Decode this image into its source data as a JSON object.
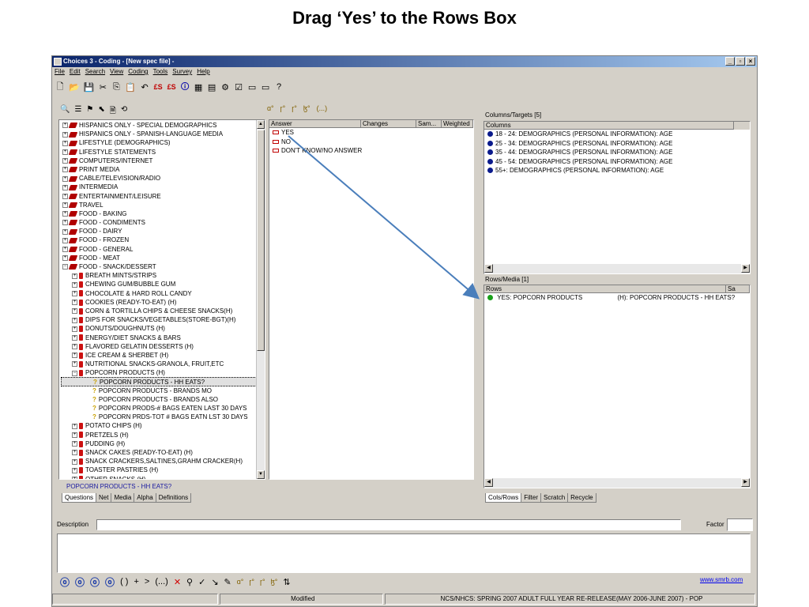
{
  "slide": {
    "title": "Drag ‘Yes’ to the Rows Box"
  },
  "window": {
    "title": "Choices 3 - Coding - [New spec file] -",
    "buttons": [
      "_",
      "▫",
      "×"
    ]
  },
  "menu": [
    "File",
    "Edit",
    "Search",
    "View",
    "Coding",
    "Tools",
    "Survey",
    "Help"
  ],
  "toolbar": [
    "🗋",
    "📂",
    "💾",
    "✂",
    "⎘",
    "📋",
    "↶",
    "£S",
    "£S",
    "🛈",
    "▦",
    "▤",
    "⚙",
    "☑",
    "▭",
    "▭",
    "?"
  ],
  "left_toolbar": [
    "🔍",
    "☰",
    "⚑",
    "⬉",
    "🗎",
    "⟲"
  ],
  "mid_toolbar": [
    "ɑ°",
    "ɼ°",
    "ɼ°",
    "ɮ°",
    "(...)"
  ],
  "tree": {
    "categories": [
      "HISPANICS ONLY - SPECIAL DEMOGRAPHICS",
      "HISPANICS ONLY - SPANISH-LANGUAGE MEDIA",
      "LIFESTYLE (DEMOGRAPHICS)",
      "LIFESTYLE STATEMENTS",
      "COMPUTERS/INTERNET",
      "PRINT MEDIA",
      "CABLE/TELEVISION/RADIO",
      "INTERMEDIA",
      "ENTERTAINMENT/LEISURE",
      "TRAVEL",
      "FOOD - BAKING",
      "FOOD - CONDIMENTS",
      "FOOD - DAIRY",
      "FOOD - FROZEN",
      "FOOD - GENERAL",
      "FOOD - MEAT"
    ],
    "open_category": "FOOD - SNACK/DESSERT",
    "subitems_before": [
      "BREATH MINTS/STRIPS",
      "CHEWING GUM/BUBBLE GUM",
      "CHOCOLATE & HARD ROLL CANDY",
      "COOKIES (READY-TO-EAT)          (H)",
      "CORN & TORTILLA CHIPS & CHEESE SNACKS(H)",
      "DIPS FOR SNACKS/VEGETABLES(STORE-BGT)(H)",
      "DONUTS/DOUGHNUTS               (H)",
      "ENERGY/DIET SNACKS & BARS",
      "FLAVORED GELATIN DESSERTS        (H)",
      "ICE CREAM & SHERBET              (H)",
      "NUTRITIONAL SNACKS-GRANOLA, FRUIT,ETC"
    ],
    "open_subitem": "POPCORN PRODUCTS                (H)",
    "questions": [
      "POPCORN PRODUCTS - HH EATS?",
      "POPCORN PRODUCTS - BRANDS MO",
      "POPCORN PRODUCTS - BRANDS ALSO",
      "POPCORN PRODS-# BAGS EATEN LAST 30 DAYS",
      "POPCORN PRDS-TOT # BAGS EATN LST 30 DAYS"
    ],
    "subitems_after": [
      "POTATO CHIPS                    (H)",
      "PRETZELS                        (H)",
      "PUDDING                         (H)",
      "SNACK CAKES (READY-TO-EAT)       (H)",
      "SNACK CRACKERS,SALTINES,GRAHM CRACKER(H)",
      "TOASTER PASTRIES                (H)",
      "OTHER SNACKS                    (H)"
    ],
    "selected_label": "POPCORN PRODUCTS - HH EATS?"
  },
  "left_tabs": [
    "Questions",
    "Net",
    "Media",
    "Alpha",
    "Definitions"
  ],
  "answers": {
    "headers": [
      "Answer",
      "Changes",
      "Sam...",
      "Weighted"
    ],
    "rows": [
      "YES",
      "NO",
      "DON'T KNOW/NO ANSWER"
    ]
  },
  "columns_targets": {
    "label": "Columns/Targets [5]",
    "header": "Columns",
    "rows": [
      "18 - 24: DEMOGRAPHICS (PERSONAL INFORMATION): AGE",
      "25 - 34: DEMOGRAPHICS (PERSONAL INFORMATION): AGE",
      "35 - 44: DEMOGRAPHICS (PERSONAL INFORMATION): AGE",
      "45 - 54: DEMOGRAPHICS (PERSONAL INFORMATION): AGE",
      "55+: DEMOGRAPHICS (PERSONAL INFORMATION): AGE"
    ],
    "dot_color": "#0a1a8c"
  },
  "rows_media": {
    "label": "Rows/Media [1]",
    "headers": [
      "Rows",
      "Sa"
    ],
    "rows": [
      {
        "left": "YES: POPCORN PRODUCTS",
        "right": "(H): POPCORN PRODUCTS - HH EATS?"
      }
    ],
    "dot_color": "#1aa01a"
  },
  "right_tabs": [
    "Cols/Rows",
    "Filter",
    "Scratch",
    "Recycle"
  ],
  "description": {
    "label": "Description",
    "factor_label": "Factor"
  },
  "bottom_toolbar": [
    "ⓞ",
    "ⓞ",
    "ⓞ",
    "ⓞ",
    "( )",
    "+",
    ">",
    "(...)",
    "✕",
    "⚲",
    "✓",
    "↘",
    "✎",
    "ɑ°",
    "ɼ°",
    "ɼ°",
    "ɮ°",
    "⇅"
  ],
  "link": "www.smrb.com",
  "status": {
    "cells": [
      "",
      "Modified",
      "NCS/NHCS:  SPRING 2007 ADULT FULL YEAR RE-RELEASE(MAY 2006-JUNE 2007) - POP"
    ]
  },
  "colors": {
    "accent": "#0a246a",
    "arrow": "#4a7ebb"
  }
}
